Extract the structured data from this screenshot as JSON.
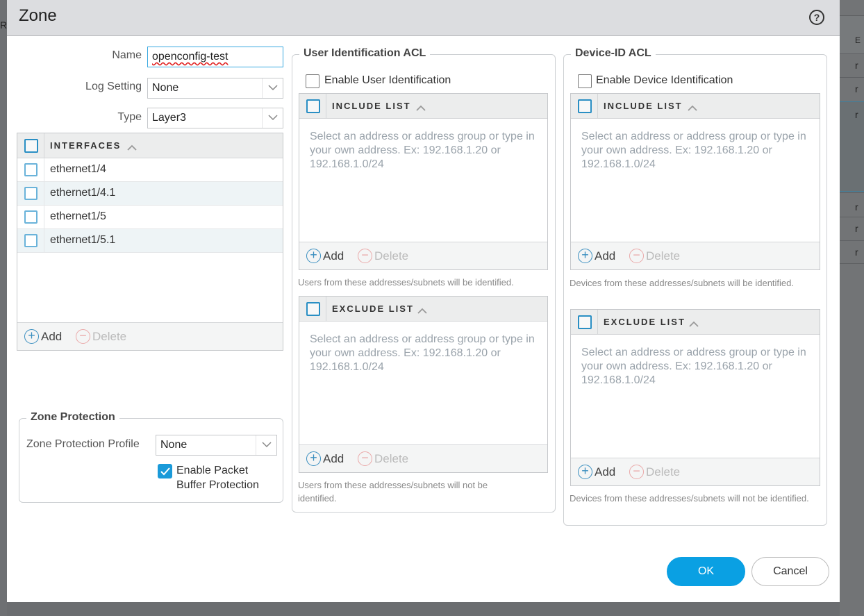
{
  "background": {
    "header_fragment": "R",
    "col_header": "E",
    "row_letters": [
      "r",
      "r",
      "r",
      "r",
      "r",
      "r"
    ]
  },
  "dialog": {
    "title": "Zone",
    "help_icon": "question-circle-icon"
  },
  "form": {
    "name_label": "Name",
    "name_value": "openconfig-test",
    "log_setting_label": "Log Setting",
    "log_setting_value": "None",
    "type_label": "Type",
    "type_value": "Layer3"
  },
  "interfaces": {
    "header": "INTERFACES",
    "items": [
      "ethernet1/4",
      "ethernet1/4.1",
      "ethernet1/5",
      "ethernet1/5.1"
    ],
    "add": "Add",
    "delete": "Delete"
  },
  "zone_protection": {
    "legend": "Zone Protection",
    "profile_label": "Zone Protection Profile",
    "profile_value": "None",
    "packet_buffer_line1": "Enable Packet",
    "packet_buffer_line2": "Buffer Protection",
    "packet_buffer_checked": true
  },
  "user_acl": {
    "legend": "User Identification ACL",
    "enable_label": "Enable User Identification",
    "enabled": false,
    "include": {
      "header": "INCLUDE LIST",
      "placeholder": "Select an address or address group or type in your own address. Ex: 192.168.1.20 or 192.168.1.0/24",
      "add": "Add",
      "delete": "Delete",
      "note": "Users from these addresses/subnets will be identified."
    },
    "exclude": {
      "header": "EXCLUDE LIST",
      "placeholder": "Select an address or address group or type in your own address. Ex: 192.168.1.20 or 192.168.1.0/24",
      "add": "Add",
      "delete": "Delete",
      "note": "Users from these addresses/subnets will not be identified."
    }
  },
  "device_acl": {
    "legend": "Device-ID ACL",
    "enable_label": "Enable Device Identification",
    "enabled": false,
    "include": {
      "header": "INCLUDE LIST",
      "placeholder": "Select an address or address group or type in your own address. Ex: 192.168.1.20 or 192.168.1.0/24",
      "add": "Add",
      "delete": "Delete",
      "note": "Devices from these addresses/subnets will be identified."
    },
    "exclude": {
      "header": "EXCLUDE LIST",
      "placeholder": "Select an address or address group or type in your own address. Ex: 192.168.1.20 or 192.168.1.0/24",
      "add": "Add",
      "delete": "Delete",
      "note": "Devices from these addresses/subnets will not be identified."
    }
  },
  "buttons": {
    "ok": "OK",
    "cancel": "Cancel"
  },
  "colors": {
    "accent": "#0aa0e3",
    "header_bg": "#dcdde0"
  }
}
